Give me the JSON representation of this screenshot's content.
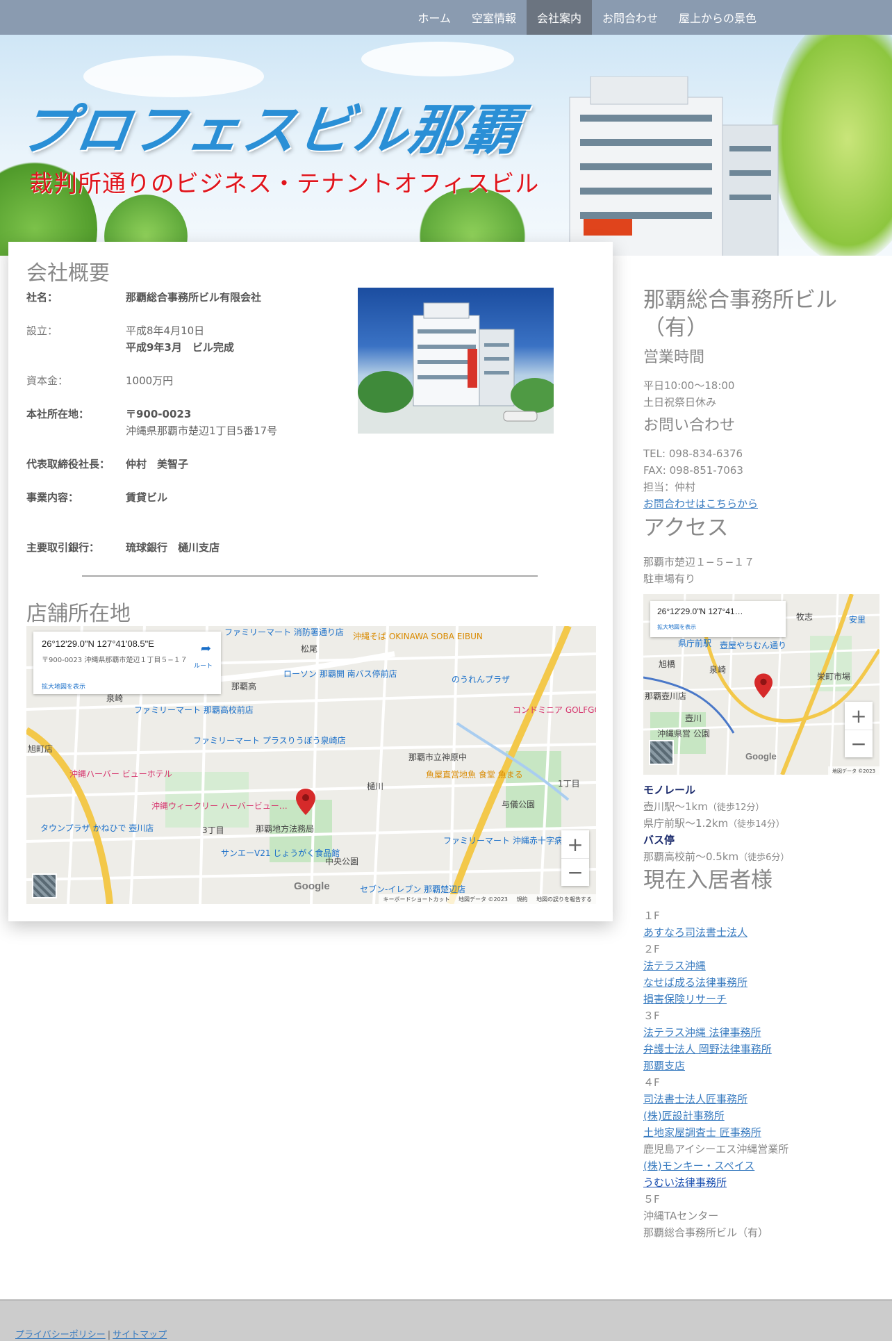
{
  "nav": {
    "items": [
      "ホーム",
      "空室情報",
      "会社案内",
      "お問合わせ",
      "屋上からの景色"
    ],
    "active": "会社案内"
  },
  "hero": {
    "title": "プロフェスビル那覇",
    "subtitle": "裁判所通りのビジネス・テナントオフィスビル",
    "title_color": "#2a8fd6",
    "subtitle_color": "#e0141c"
  },
  "overview": {
    "heading": "会社概要",
    "rows": [
      {
        "label": "社名：",
        "value": "那覇総合事務所ビル有限会社"
      },
      {
        "label": "設立：",
        "value": "平成8年4月10日",
        "value2": "平成9年3月　ビル完成"
      },
      {
        "label": "資本金：",
        "value": "1000万円"
      },
      {
        "label": "本社所在地：",
        "value": "〒900-0023",
        "value2": "沖縄県那覇市楚辺1丁目5番17号"
      },
      {
        "label": "代表取締役社長：",
        "value": "仲村　美智子"
      },
      {
        "label": "事業内容：",
        "value": "賃貸ビル"
      },
      {
        "label": "主要取引銀行：",
        "value": "琉球銀行　樋川支店"
      }
    ]
  },
  "store": {
    "heading": "店舗所在地",
    "map": {
      "coords": "26°12'29.0\"N 127°41'08.5\"E",
      "address": "〒900-0023 沖縄県那覇市楚辺１丁目５−１７",
      "larger_map": "拡大地図を表示",
      "route": "ルート",
      "labels": [
        "ファミリーマート 消防署通り店",
        "沖縄そば OKINAWA SOBA EIBUN",
        "松尾",
        "ローソン 那覇開 南バス停前店",
        "のうれんプラザ",
        "コンドミニア GOLFGOLF 壺屋 GO",
        "ファミリーマート 那覇高校前店",
        "ファミリーマート プラスりうぼう泉崎店",
        "那覇市立神原中",
        "沖縄ハーバー ビューホテル",
        "魚屋直営地魚 食堂 魚まる",
        "樋川",
        "与儀公園",
        "1丁目",
        "沖縄ウィークリー ハーバービュー…",
        "タウンプラザ かねひで 壺川店",
        "3丁目",
        "那覇地方法務局",
        "ファミリーマート 沖縄赤十字病院店",
        "サンエーV21 じょうがく食品館",
        "中央公園",
        "旭町店",
        "那覇高",
        "泉崎",
        "セブン-イレブン 那覇楚辺店",
        "キーボードショートカット",
        "地図データ ©2023",
        "規約",
        "地図の誤りを報告する"
      ],
      "google": "Google"
    }
  },
  "sidebar": {
    "company": "那覇総合事務所ビル（有）",
    "hours_heading": "営業時間",
    "hours": [
      "平日10:00～18:00",
      "土日祝祭日休み"
    ],
    "contact_heading": "お問い合わせ",
    "tel": "TEL: 098-834-6376",
    "fax": "FAX: 098-851-7063",
    "person": "担当：仲村",
    "contact_link": "お問合わせはこちらから",
    "access_heading": "アクセス",
    "address": "那覇市楚辺１−５−１７",
    "parking": "駐車場有り",
    "mini_map": {
      "coords": "26°12'29.0\"N 127°41…",
      "larger_map": "拡大地図を表示",
      "labels": [
        "泉崎",
        "壺屋やちむん通り",
        "沖縄県営 公園",
        "旭橋",
        "県庁前駅",
        "那覇壺川店",
        "安里",
        "牧志",
        "栄町市場",
        "壺川"
      ],
      "footer": "地図データ ©2023"
    },
    "monorail_heading": "モノレール",
    "monorail": [
      {
        "station": "壺川駅〜1km",
        "note": "（徒歩12分）"
      },
      {
        "station": "県庁前駅〜1.2km",
        "note": "（徒歩14分）"
      }
    ],
    "bus_heading": "バス停",
    "bus": {
      "stop": "那覇高校前〜0.5km",
      "note": "（徒歩6分）"
    },
    "tenants_heading": "現在入居者様",
    "floors": [
      {
        "floor": "１F",
        "tenants": [
          {
            "name": "あすなろ司法書士法人",
            "link": true
          }
        ]
      },
      {
        "floor": "２F",
        "tenants": [
          {
            "name": "法テラス沖縄",
            "link": true
          },
          {
            "name": "なせば成る法律事務所",
            "link": true
          },
          {
            "name": "損害保険リサーチ",
            "link": true
          }
        ]
      },
      {
        "floor": "３F",
        "tenants": [
          {
            "name": "法テラス沖縄 法律事務所",
            "link": true
          },
          {
            "name": "弁護士法人 岡野法律事務所",
            "link": true
          },
          {
            "name": "那覇支店",
            "link": true
          }
        ]
      },
      {
        "floor": "４F",
        "tenants": [
          {
            "name": "司法書士法人匠事務所",
            "link": true
          },
          {
            "name": "(株)匠設計事務所",
            "link": true
          },
          {
            "name": "土地家屋調査士 匠事務所",
            "link": true
          },
          {
            "name": "鹿児島アイシーエス沖縄営業所",
            "link": false
          },
          {
            "name": "(株)モンキー・スペイス",
            "link": true
          },
          {
            "name": "うむい法律事務所",
            "link": true
          }
        ]
      },
      {
        "floor": "５F",
        "tenants": [
          {
            "name": "沖縄TAセンター",
            "link": false
          },
          {
            "name": "那覇総合事務所ビル（有）",
            "link": false
          }
        ]
      }
    ]
  },
  "footer": {
    "privacy": "プライバシーポリシー",
    "separator": "|",
    "sitemap": "サイトマップ"
  },
  "colors": {
    "nav_bg": "#8a9bb0",
    "nav_active": "#6b7480",
    "link": "#3a7cc0",
    "heading_gray": "#888888",
    "pin": "#d62a2a"
  }
}
